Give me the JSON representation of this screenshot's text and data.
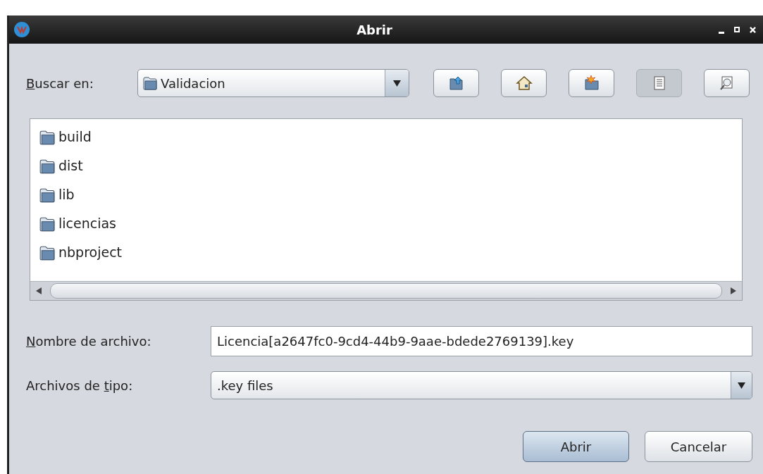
{
  "window": {
    "title": "Abrir"
  },
  "look_in": {
    "label": {
      "key": "B",
      "after": "uscar en:"
    },
    "value": "Validacion"
  },
  "toolbar": [
    {
      "kind": "up",
      "selected": false
    },
    {
      "kind": "home",
      "selected": false
    },
    {
      "kind": "new-folder",
      "selected": false
    },
    {
      "kind": "list",
      "selected": true
    },
    {
      "kind": "details",
      "selected": false
    }
  ],
  "files": [
    {
      "name": "build"
    },
    {
      "name": "dist"
    },
    {
      "name": "lib"
    },
    {
      "name": "licencias"
    },
    {
      "name": "nbproject"
    }
  ],
  "file_name": {
    "label": {
      "key": "N",
      "after": "ombre de archivo:"
    },
    "value": "Licencia[a2647fc0-9cd4-44b9-9aae-bdede2769139].key"
  },
  "file_type": {
    "label": {
      "before": "Archivos de ",
      "key": "t",
      "after": "ipo:"
    },
    "value": ".key files"
  },
  "buttons": [
    {
      "label": "Abrir",
      "kind": "primary"
    },
    {
      "label": "Cancelar",
      "kind": "secondary"
    }
  ]
}
